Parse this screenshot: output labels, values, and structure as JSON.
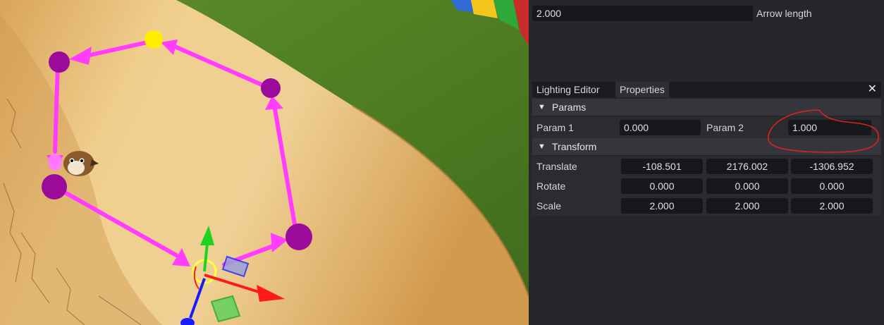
{
  "panel": {
    "top_field": {
      "value": "2.000",
      "label": "Arrow length"
    },
    "tabs": [
      {
        "label": "Lighting Editor",
        "active": false
      },
      {
        "label": "Properties",
        "active": true
      }
    ],
    "close_icon": "close-icon",
    "params": {
      "title": "Params",
      "param1": {
        "label": "Param 1",
        "value": "0.000"
      },
      "param2": {
        "label": "Param 2",
        "value": "1.000"
      }
    },
    "transform": {
      "title": "Transform",
      "translate": {
        "label": "Translate",
        "x": "-108.501",
        "y": "2176.002",
        "z": "-1306.952"
      },
      "rotate": {
        "label": "Rotate",
        "x": "0.000",
        "y": "0.000",
        "z": "0.000"
      },
      "scale": {
        "label": "Scale",
        "x": "2.000",
        "y": "2.000",
        "z": "2.000"
      }
    }
  },
  "viewport": {
    "path_color": "#ff3cff",
    "node_color": "#9c0a9c",
    "start_node_color": "#ffee00",
    "annotation_color": "#e02020",
    "gizmo_colors": {
      "x": "#ff1a1a",
      "y": "#1ed21e",
      "z": "#1a1aff"
    }
  }
}
